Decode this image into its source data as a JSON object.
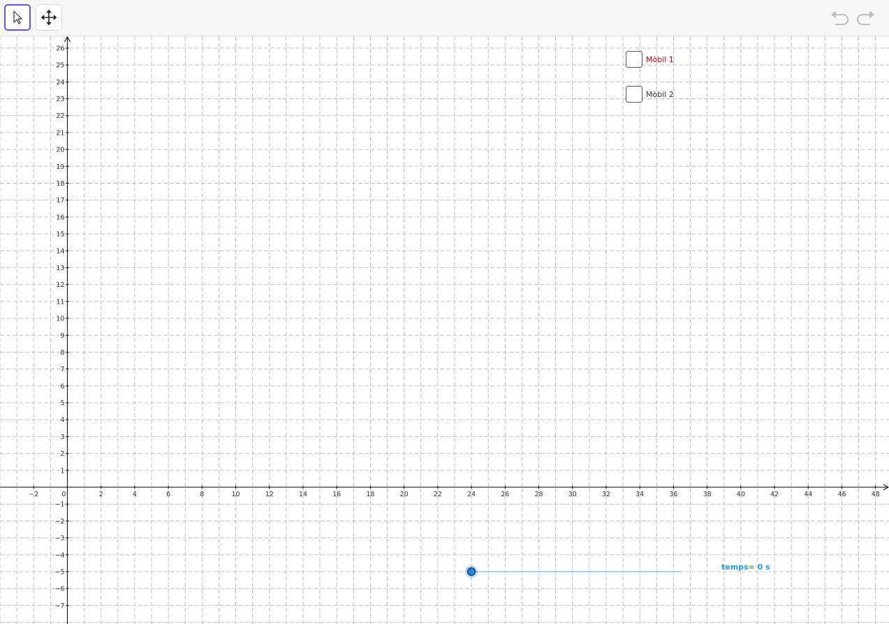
{
  "toolbar": {
    "tools": [
      {
        "name": "move-tool",
        "icon": "arrow-pointer-icon",
        "active": true
      },
      {
        "name": "move-graphics-view-tool",
        "icon": "four-arrows-icon",
        "active": false
      }
    ],
    "undo_icon": "undo-icon",
    "redo_icon": "redo-icon"
  },
  "graphics": {
    "x_range": [
      -4,
      48.8
    ],
    "y_range": [
      -8.1,
      26.7
    ],
    "x_tick_step": 2,
    "y_tick_step": 1,
    "x_tick_labels": [
      "−2",
      "0",
      "2",
      "4",
      "6",
      "8",
      "10",
      "12",
      "14",
      "16",
      "18",
      "20",
      "22",
      "24",
      "26",
      "28",
      "30",
      "32",
      "34",
      "36",
      "38",
      "40",
      "42",
      "44",
      "46",
      "48"
    ],
    "y_tick_labels": [
      "26",
      "25",
      "24",
      "23",
      "22",
      "21",
      "20",
      "19",
      "18",
      "17",
      "16",
      "15",
      "14",
      "13",
      "12",
      "11",
      "10",
      "9",
      "8",
      "7",
      "6",
      "5",
      "4",
      "3",
      "2",
      "1",
      "−1",
      "−2",
      "−3",
      "−4",
      "−5",
      "−6",
      "−7"
    ],
    "grid": "dashed",
    "grid_color": "#c0c0c0",
    "axis_color": "#000000"
  },
  "checkboxes": [
    {
      "label": "Mòbil 1",
      "checked": false,
      "color": "#cc0000"
    },
    {
      "label": "Mòbil 2",
      "checked": false,
      "color": "#333333"
    }
  ],
  "slider": {
    "label": "temps= 0 s",
    "value": 0,
    "point_x": 24,
    "end_x": 36.5,
    "y": -5,
    "color": "#1565c0",
    "label_color": "#1e9be0"
  }
}
